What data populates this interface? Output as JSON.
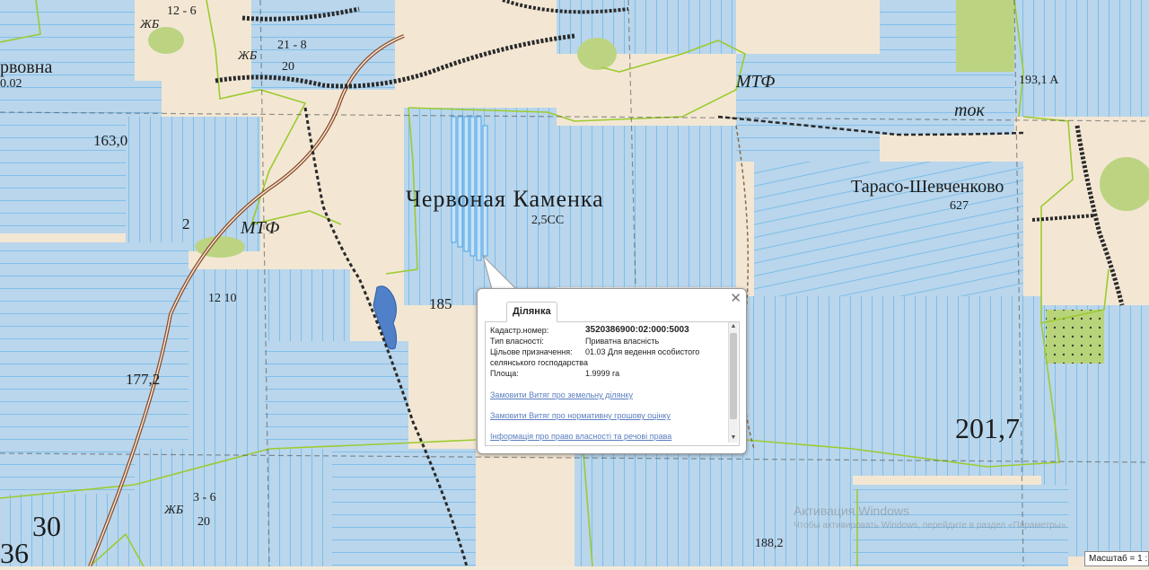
{
  "map": {
    "labels": {
      "town_main": "Червоная Каменка",
      "town_east": "Тарасо-Шевченково",
      "town_west": "рвовна",
      "mtf_west": "МТФ",
      "mtf_north": "МТФ",
      "tok": "ток",
      "h163": "163,0",
      "h177": "177,2",
      "h201": "201,7",
      "h185": "185",
      "h30": "30",
      "h36": "36",
      "h2": "2",
      "jb_top": "ЖБ",
      "jb_mid": "ЖБ",
      "jb_bot": "ЖБ",
      "n2_5ss": "2,5СС",
      "n627": "627",
      "n0_02": "0.02",
      "n12_6": "12 - 6",
      "n21_8": "21 - 8",
      "n20": "20",
      "n3_6": "3 - 6",
      "n20b": "20",
      "n12_10": "12 10",
      "n188": "188,2",
      "n193": "193,1 Α"
    }
  },
  "popup": {
    "tab": "Ділянка",
    "close_icon": "close-icon",
    "fields": [
      {
        "key": "Кадастр.номер:",
        "value": "3520386900:02:000:5003"
      },
      {
        "key": "Тип власності:",
        "value": "Приватна власність"
      },
      {
        "key": "Цільове призначення:",
        "value": "01.03 Для ведення особистого"
      },
      {
        "key": "",
        "value": "селянського господарства"
      },
      {
        "key": "Площа:",
        "value": "1.9999 га"
      }
    ],
    "links": [
      "Замовити Витяг про земельну ділянку",
      "Замовити Витяг про нормативну грошову оцінку",
      "Інформація про право власності та речові права"
    ]
  },
  "scale_label": "Масштаб = 1 :",
  "watermark": {
    "line1": "Активация Windows",
    "line2": "Чтобы активировать Windows, перейдите в раздел «Параметры»."
  },
  "colors": {
    "parcel_fill": "#b9d6ec",
    "parcel_line": "#6fb8e8",
    "boundary": "#9ccb30",
    "road_dark": "#2a2a2a",
    "road_brown": "#8a4a2a",
    "map_bg": "#f4e9d8"
  }
}
